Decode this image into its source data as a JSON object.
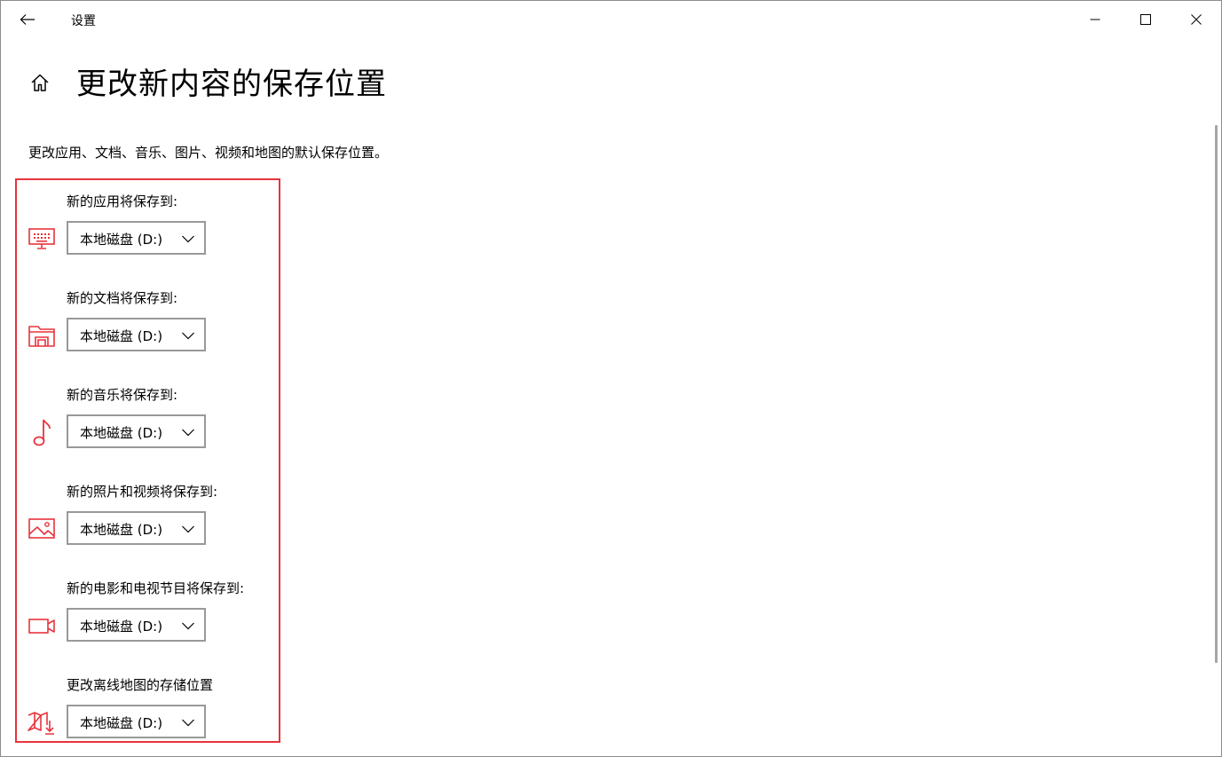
{
  "titlebar": {
    "app_title": "设置",
    "icons": {
      "back": "back-arrow-icon",
      "minimize": "minimize-icon",
      "maximize": "maximize-icon",
      "close": "close-icon"
    }
  },
  "header": {
    "home_icon": "home-icon",
    "title": "更改新内容的保存位置"
  },
  "description": "更改应用、文档、音乐、图片、视频和地图的默认保存位置。",
  "accent_color": "#e8333c",
  "settings": [
    {
      "label": "新的应用将保存到:",
      "icon": "monitor-keyboard-icon",
      "selected": "本地磁盘 (D:)"
    },
    {
      "label": "新的文档将保存到:",
      "icon": "document-folder-icon",
      "selected": "本地磁盘 (D:)"
    },
    {
      "label": "新的音乐将保存到:",
      "icon": "music-note-icon",
      "selected": "本地磁盘 (D:)"
    },
    {
      "label": "新的照片和视频将保存到:",
      "icon": "picture-icon",
      "selected": "本地磁盘 (D:)"
    },
    {
      "label": "新的电影和电视节目将保存到:",
      "icon": "video-camera-icon",
      "selected": "本地磁盘 (D:)"
    },
    {
      "label": "更改离线地图的存储位置",
      "icon": "map-download-icon",
      "selected": "本地磁盘 (D:)"
    }
  ]
}
